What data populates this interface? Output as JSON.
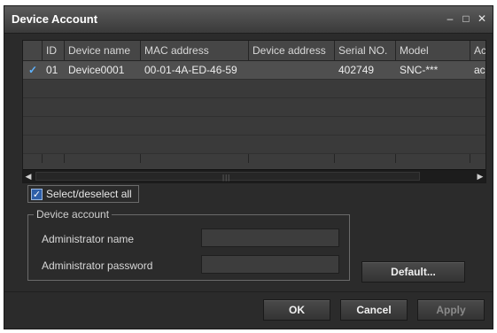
{
  "window": {
    "title": "Device Account"
  },
  "table": {
    "columns": [
      "ID",
      "Device name",
      "MAC address",
      "Device address",
      "Serial NO.",
      "Model",
      "Ac"
    ],
    "rows": [
      {
        "checked": true,
        "id": "01",
        "device_name": "Device0001",
        "mac": "00-01-4A-ED-46-59",
        "device_address": "",
        "serial": "402749",
        "model": "SNC-***",
        "ac": "ac"
      }
    ]
  },
  "select_all": {
    "label": "Select/deselect all",
    "checked": true
  },
  "device_account": {
    "legend": "Device account",
    "admin_name_label": "Administrator name",
    "admin_name_value": "",
    "admin_password_label": "Administrator password",
    "admin_password_value": ""
  },
  "buttons": {
    "default": "Default...",
    "ok": "OK",
    "cancel": "Cancel",
    "apply": "Apply"
  },
  "icons": {
    "check": "✓",
    "minimize": "–",
    "maximize": "□",
    "close": "✕",
    "left": "◀",
    "right": "▶",
    "grip": "|||"
  }
}
